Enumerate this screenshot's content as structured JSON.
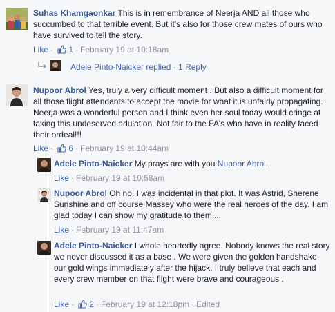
{
  "comments": [
    {
      "author": "Suhas Khamgaonkar",
      "body": "This is in remembrance of Neerja AND all those who succumbed to that terrible event. But it's also for those crew mates of ours who have survived to tell the story.",
      "like_label": "Like",
      "like_count": "1",
      "time": "February 19 at 10:18am"
    },
    {
      "author": "Nupoor Abrol",
      "body": "Yes, truly a very difficult moment . But also a difficult moment for all those flight attendants to accept the movie for what it is unfairly propagating. Neerja was a wonderful person and I think even her soul today would cringe at taking this undeserved adulation. Not fair to the FA's who have in reality faced their ordeal!!!",
      "like_label": "Like",
      "like_count": "6",
      "time": "February 19 at 10:44am"
    }
  ],
  "reply_summary": {
    "text": "Adele Pinto-Naicker replied · 1 Reply"
  },
  "replies": [
    {
      "author": "Adele Pinto-Naicker",
      "body": "My prays are with you",
      "mention": "Nupoor Abrol",
      "after_mention": ",",
      "like_label": "Like",
      "time": "February 19 at 10:58am"
    },
    {
      "author": "Nupoor Abrol",
      "body": "Oh no! I was incidental in that plot. It was Astrid, Sherene, Sunshine and off course Massey who were the real heroes of the day. I am glad today I can show my gratitude to them....",
      "like_label": "Like",
      "time": "February 19 at 11:47am"
    },
    {
      "author": "Adele Pinto-Naicker",
      "body": "I whole heartedly agree. Nobody knows the real story we never discussed it as a base . We were given the golden handshake our gold wings immediately after the hijack. I truly believe that each and every crew member on that flight were brave and courageous .",
      "like_label": "Like",
      "like_count": "2",
      "time": "February 19 at 12:18pm",
      "edited": "Edited"
    }
  ],
  "separator": "·",
  "colors": {
    "link": "#365899",
    "action": "#4267b2",
    "meta": "#90949c",
    "text": "#1d2129",
    "background": "#f6f7f9"
  }
}
